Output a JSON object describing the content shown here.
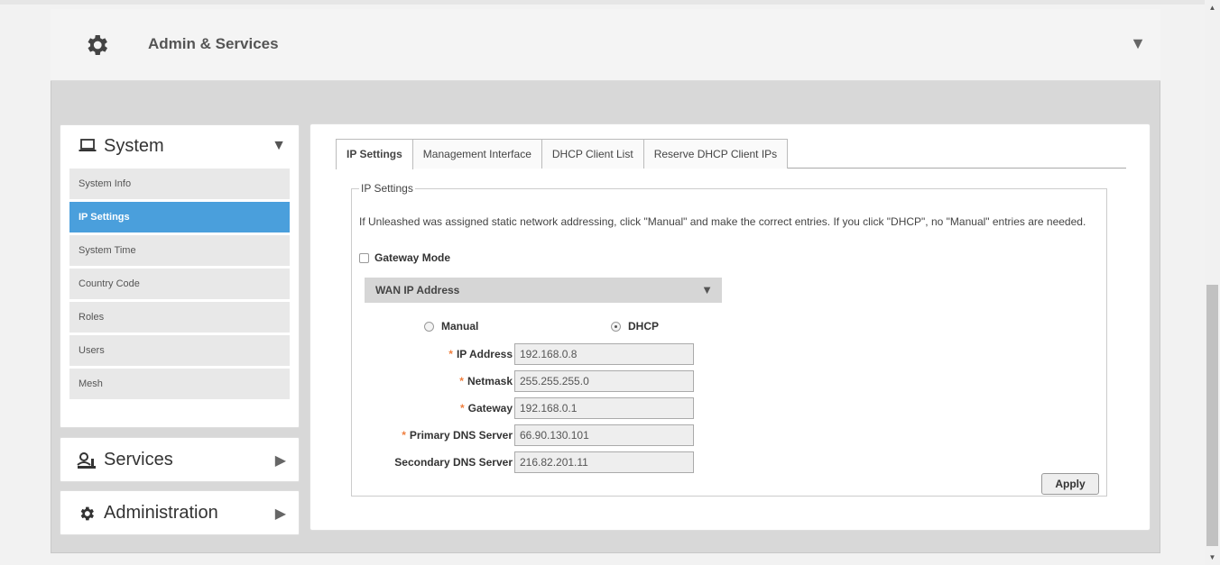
{
  "header": {
    "title": "Admin & Services",
    "icon": "gear-icon"
  },
  "sidebar": {
    "system": {
      "title": "System",
      "icon": "laptop-icon"
    },
    "items": [
      {
        "label": "System Info",
        "active": false
      },
      {
        "label": "IP Settings",
        "active": true
      },
      {
        "label": "System Time",
        "active": false
      },
      {
        "label": "Country Code",
        "active": false
      },
      {
        "label": "Roles",
        "active": false
      },
      {
        "label": "Users",
        "active": false
      },
      {
        "label": "Mesh",
        "active": false
      }
    ],
    "services": {
      "title": "Services",
      "icon": "services-icon"
    },
    "administration": {
      "title": "Administration",
      "icon": "gear-icon"
    }
  },
  "tabs": [
    {
      "label": "IP Settings",
      "active": true
    },
    {
      "label": "Management Interface",
      "active": false
    },
    {
      "label": "DHCP Client List",
      "active": false
    },
    {
      "label": "Reserve DHCP Client IPs",
      "active": false
    }
  ],
  "ip_settings": {
    "legend": "IP Settings",
    "description": "If Unleashed was assigned static network addressing, click \"Manual\" and make the correct entries. If you click \"DHCP\", no \"Manual\" entries are needed.",
    "gateway_mode_label": "Gateway Mode",
    "gateway_mode_checked": false,
    "wan_title": "WAN IP Address",
    "mode_manual": "Manual",
    "mode_dhcp": "DHCP",
    "selected_mode": "DHCP",
    "required_marker": "*",
    "fields": {
      "ip_address": {
        "label": "IP Address",
        "value": "192.168.0.8"
      },
      "netmask": {
        "label": "Netmask",
        "value": "255.255.255.0"
      },
      "gateway": {
        "label": "Gateway",
        "value": "192.168.0.1"
      },
      "primary_dns": {
        "label": "Primary DNS Server",
        "value": "66.90.130.101"
      },
      "secondary_dns": {
        "label": "Secondary DNS Server",
        "value": "216.82.201.11"
      }
    },
    "apply_label": "Apply"
  },
  "colors": {
    "active_item": "#4a9fdc",
    "required": "#f08040"
  }
}
